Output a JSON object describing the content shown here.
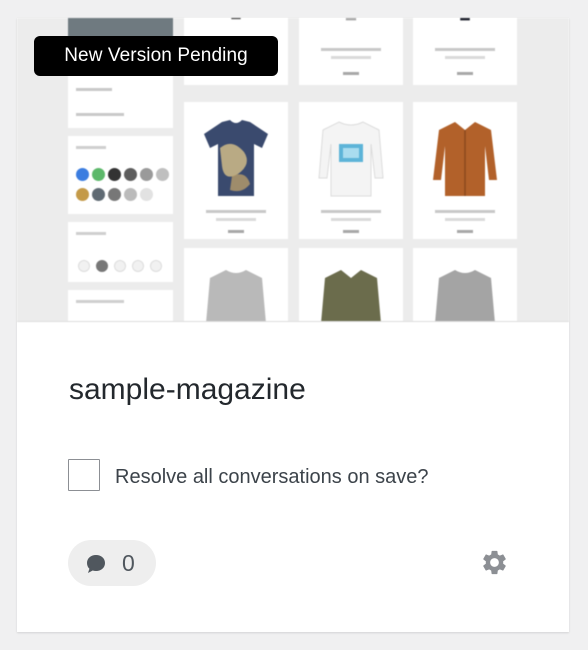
{
  "badge": {
    "label": "New Version Pending"
  },
  "site": {
    "title": "sample-magazine"
  },
  "resolve": {
    "label": "Resolve all conversations on save?",
    "checked": false
  },
  "comments": {
    "count": "0",
    "icon": "speech-bubble-icon"
  },
  "settings": {
    "icon": "gear-icon"
  },
  "preview": {
    "swatches": [
      "#3b7de0",
      "#5cb86a",
      "#333333",
      "#5d5d5d",
      "#9a9a9a",
      "#bfbfbf",
      "#c49a48",
      "#5f6a73",
      "#777777",
      "#bbbbbb",
      "#e2e2e2"
    ]
  },
  "colors": {
    "badge_bg": "#000000",
    "card_bg": "#ffffff",
    "page_bg": "#f0f0f1"
  }
}
